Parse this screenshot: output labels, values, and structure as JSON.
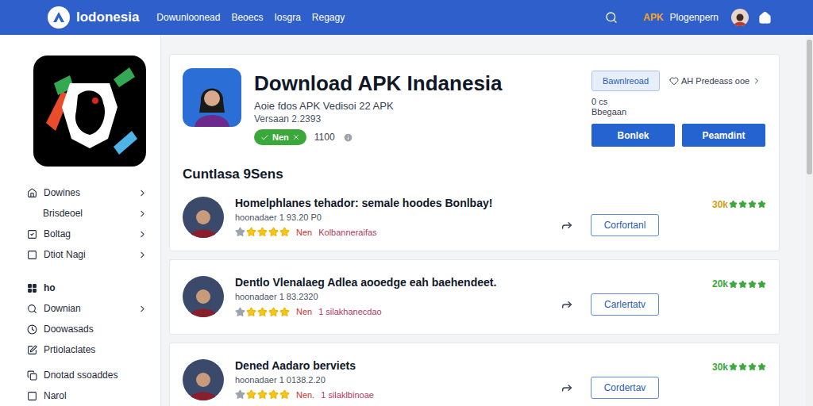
{
  "topbar": {
    "logo": "lodonesia",
    "nav": [
      "Dowunloonead",
      "Beoecs",
      "Iosgra",
      "Regagy"
    ],
    "apk": "APK",
    "user": "Plogenpern"
  },
  "sidebar": {
    "items": [
      {
        "label": "Dowines",
        "kind": "link",
        "expandable": true
      },
      {
        "label": "Brisdeoel",
        "kind": "sub",
        "expandable": true
      },
      {
        "label": "Boltag",
        "kind": "link",
        "expandable": true
      },
      {
        "label": "Dtiot Nagi",
        "kind": "link",
        "expandable": true
      },
      {
        "label": "ho",
        "kind": "section",
        "expandable": false
      },
      {
        "label": "Downian",
        "kind": "link",
        "expandable": true
      },
      {
        "label": "Doowasads",
        "kind": "link",
        "expandable": false
      },
      {
        "label": "Prtiolaclates",
        "kind": "link",
        "expandable": false
      },
      {
        "label": "Dnotad ssoaddes",
        "kind": "link",
        "expandable": false
      },
      {
        "label": "Narol",
        "kind": "link",
        "expandable": false
      }
    ]
  },
  "app": {
    "title": "Download APK Indanesia",
    "subtitle": "Aoie fdos APK Vedisoi 22 APK",
    "version": "Versaan 2.2393",
    "badge": "Nen",
    "count": "1100",
    "download_button": "Bawnlreoad",
    "more_link": "AH Predeass ooe",
    "size": "0 cs",
    "category": "Bbegaan",
    "buttons": [
      "Bonlek",
      "Peamdint"
    ]
  },
  "section_title": "Cuntlasa 9Sens",
  "list": [
    {
      "title": "Homelphlanes tehador: semale hoodes Bonlbay!",
      "meta": "hoonadaer 1 93.20 P0",
      "stars": 4,
      "label": "Nen",
      "tag": "Kolbanneraifas",
      "button": "Corfortanl",
      "rating": "30k",
      "rating_stars": 4,
      "rating_color": "#d4a017"
    },
    {
      "title": "Dentlo Vlenalaeg Adlea aooedge eah baehendeet.",
      "meta": "hoonadaer 1 83.2320",
      "stars": 4,
      "label": "Nen",
      "tag": "1 silakhanecdao",
      "button": "Carlertatv",
      "rating": "20k",
      "rating_stars": 4,
      "rating_color": "#3aa83a"
    },
    {
      "title": "Dened Aadaro berviets",
      "meta": "hoonadaer 1 0138.2.20",
      "stars": 4,
      "label": "Nen.",
      "tag": "1 silaklbinoae",
      "button": "Cordertav",
      "rating": "30k",
      "rating_stars": 4,
      "rating_color": "#3aa83a"
    }
  ]
}
